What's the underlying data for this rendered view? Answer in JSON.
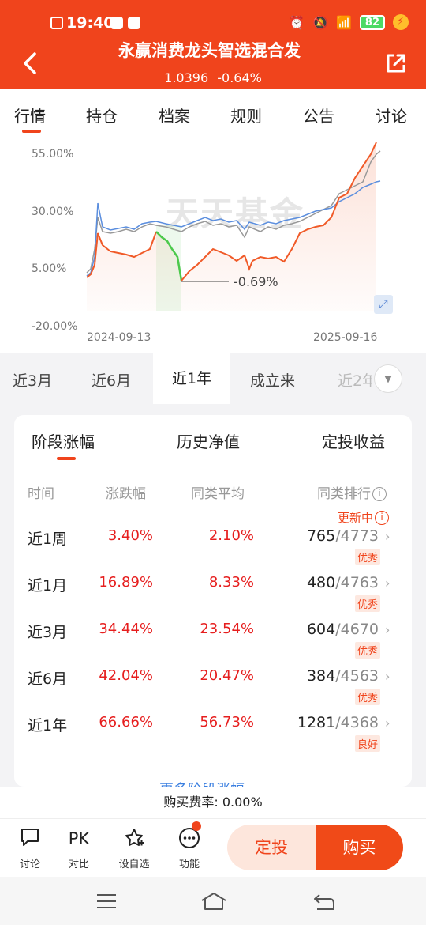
{
  "status": {
    "time": "19:40",
    "battery": "82"
  },
  "header": {
    "title": "永赢消费龙头智选混合发",
    "nav": "1.0396",
    "change": "-0.64%"
  },
  "tabs": [
    "行情",
    "持仓",
    "档案",
    "规则",
    "公告",
    "讨论"
  ],
  "chart": {
    "watermark": "天天基金",
    "y_ticks": [
      "55.00%",
      "30.00%",
      "5.00%",
      "-20.00%"
    ],
    "x_start": "2024-09-13",
    "x_end": "2025-09-16",
    "max_drawdown_label": "-0.69%",
    "colors": {
      "fund": "#f05a28",
      "average": "#5b8ede",
      "index": "#999999",
      "drawdown": "#4cc94c"
    }
  },
  "periods": [
    "近3月",
    "近6月",
    "近1年",
    "成立来",
    "近2年"
  ],
  "card": {
    "tabs": [
      "阶段涨幅",
      "历史净值",
      "定投收益"
    ],
    "headers": [
      "时间",
      "涨跌幅",
      "同类平均",
      "同类排行"
    ],
    "updating": "更新中",
    "rows": [
      {
        "period": "近1周",
        "change": "3.40%",
        "avg": "2.10%",
        "rank": "765",
        "total": "4773",
        "badge": "优秀"
      },
      {
        "period": "近1月",
        "change": "16.89%",
        "avg": "8.33%",
        "rank": "480",
        "total": "4763",
        "badge": "优秀"
      },
      {
        "period": "近3月",
        "change": "34.44%",
        "avg": "23.54%",
        "rank": "604",
        "total": "4670",
        "badge": "优秀"
      },
      {
        "period": "近6月",
        "change": "42.04%",
        "avg": "20.47%",
        "rank": "384",
        "total": "4563",
        "badge": "优秀"
      },
      {
        "period": "近1年",
        "change": "66.66%",
        "avg": "56.73%",
        "rank": "1281",
        "total": "4368",
        "badge": "良好"
      }
    ],
    "more": "更多阶段涨幅"
  },
  "fee": "购买费率: 0.00%",
  "bottom": {
    "items": [
      {
        "label": "讨论",
        "icon": "chat-icon"
      },
      {
        "label": "对比",
        "icon": "PK"
      },
      {
        "label": "设自选",
        "icon": "star-plus-icon"
      },
      {
        "label": "功能",
        "icon": "more-icon"
      }
    ],
    "dingtou": "定投",
    "buy": "购买"
  }
}
